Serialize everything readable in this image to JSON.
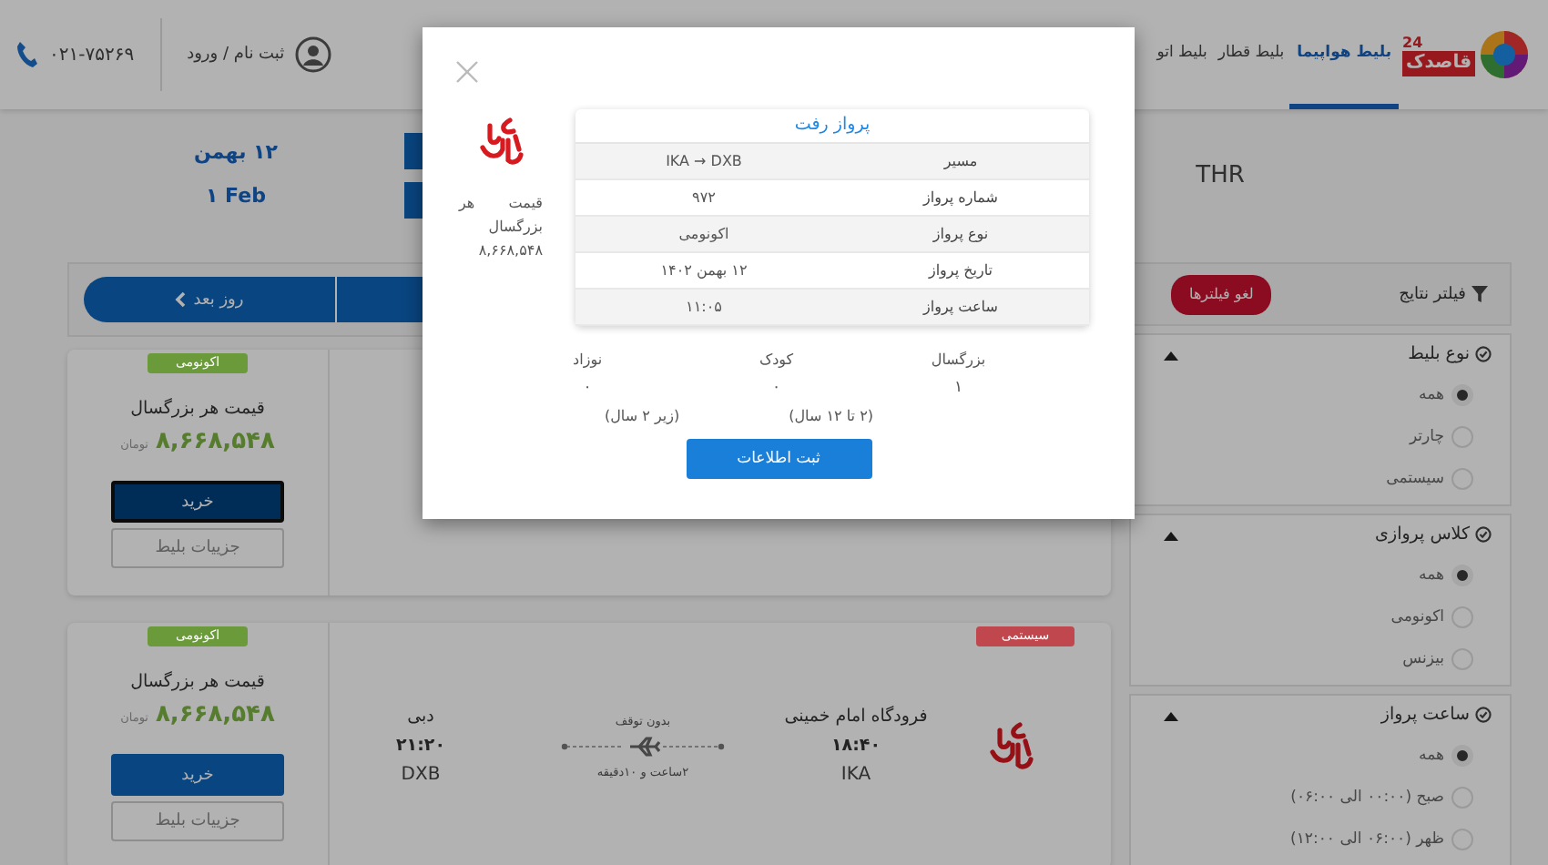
{
  "header": {
    "logo": {
      "name": "قاصدک",
      "badge": "24"
    },
    "nav_tabs": [
      {
        "label": "بلیط هواپیما",
        "selected": true
      },
      {
        "label": "بلیط قطار",
        "selected": false
      },
      {
        "label": "بلیط اتو",
        "selected": false
      }
    ],
    "login": "ثبت نام / ورود",
    "phone": "۰۲۱-۷۵۲۶۹"
  },
  "search_summary": {
    "origin": "THR",
    "date_fa": "۱۲ بهمن",
    "date_en": "۱ Feb"
  },
  "date_nav": {
    "next_day": "روز بعد"
  },
  "filters": {
    "title": "فیلتر نتایج",
    "clear": "لغو فیلترها",
    "groups": [
      {
        "title": "نوع بلیط",
        "expanded": true,
        "options": [
          {
            "label": "همه",
            "selected": true
          },
          {
            "label": "چارتر",
            "selected": false
          },
          {
            "label": "سیستمی",
            "selected": false
          }
        ]
      },
      {
        "title": "کلاس پروازی",
        "expanded": true,
        "options": [
          {
            "label": "همه",
            "selected": true
          },
          {
            "label": "اکونومی",
            "selected": false
          },
          {
            "label": "بیزنس",
            "selected": false
          }
        ]
      },
      {
        "title": "ساعت پرواز",
        "expanded": true,
        "options": [
          {
            "label": "همه",
            "selected": true
          },
          {
            "label": "صبح (۰۰:۰۰ الی ۰۶:۰۰)",
            "selected": false
          },
          {
            "label": "ظهر (۰۶:۰۰ الی ۱۲:۰۰)",
            "selected": false
          }
        ]
      }
    ]
  },
  "results": [
    {
      "badges": [
        {
          "kind": "class",
          "label": "اکونومی",
          "color": "#6a9a3a"
        }
      ],
      "price_label": "قیمت هر بزرگسال",
      "price": "۸,۶۶۸,۵۴۸",
      "currency": "تومان",
      "buy": {
        "label": "خرید",
        "focused": true
      },
      "details": "جزییات بلیط"
    },
    {
      "badges": [
        {
          "kind": "type",
          "label": "سیستمی",
          "color": "#c0474d"
        },
        {
          "kind": "class",
          "label": "اکونومی",
          "color": "#6a9a3a"
        }
      ],
      "flight": {
        "origin_name": "فرودگاه امام خمینی",
        "origin_time": "۱۸:۴۰",
        "origin_code": "IKA",
        "stops": "بدون توقف",
        "duration": "۲ساعت و ۱۰دقیقه",
        "dest_name": "دبی",
        "dest_time": "۲۱:۲۰",
        "dest_code": "DXB"
      },
      "price_label": "قیمت هر بزرگسال",
      "price": "۸,۶۶۸,۵۴۸",
      "currency": "تومان",
      "buy": {
        "label": "خرید",
        "focused": false
      },
      "details": "جزییات بلیط"
    }
  ],
  "modal": {
    "price_text": "قیمت هر بزرگسال ۸,۶۶۸,۵۴۸",
    "table": {
      "title": "پرواز رفت",
      "rows": [
        {
          "label": "مسیر",
          "value": "IKA → DXB"
        },
        {
          "label": "شماره پرواز",
          "value": "۹۷۲"
        },
        {
          "label": "نوع پرواز",
          "value": "اکونومی"
        },
        {
          "label": "تاریخ پرواز",
          "value": "۱۲ بهمن ۱۴۰۲"
        },
        {
          "label": "ساعت پرواز",
          "value": "۱۱:۰۵"
        }
      ]
    },
    "passengers": [
      {
        "label": "بزرگسال",
        "count": "۱"
      },
      {
        "label": "کودک",
        "count": "۰",
        "note": "(۲ تا ۱۲ سال)"
      },
      {
        "label": "نوزاد",
        "count": "۰",
        "note": "(زیر ۲ سال)"
      }
    ],
    "submit": "ثبت اطلاعات"
  }
}
